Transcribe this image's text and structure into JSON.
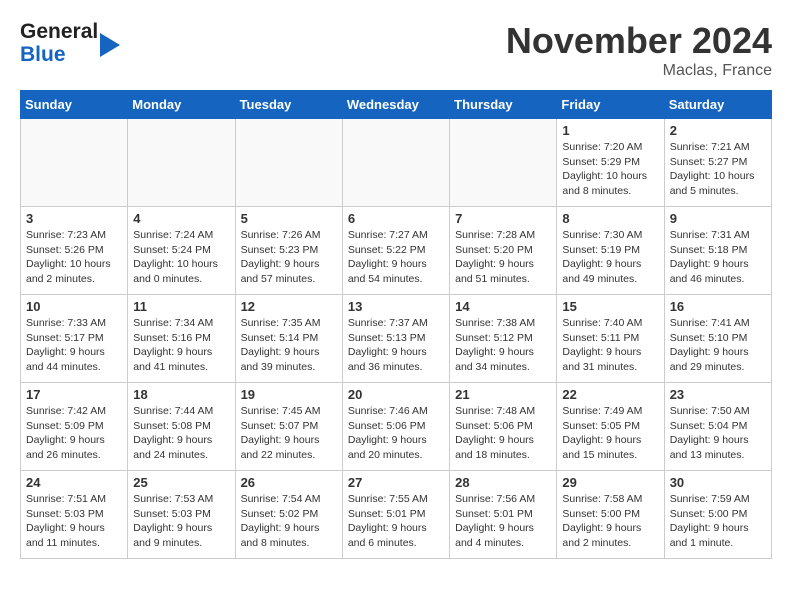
{
  "header": {
    "logo_top": "General",
    "logo_bottom": "Blue",
    "month_title": "November 2024",
    "location": "Maclas, France"
  },
  "weekdays": [
    "Sunday",
    "Monday",
    "Tuesday",
    "Wednesday",
    "Thursday",
    "Friday",
    "Saturday"
  ],
  "weeks": [
    [
      {
        "day": "",
        "info": ""
      },
      {
        "day": "",
        "info": ""
      },
      {
        "day": "",
        "info": ""
      },
      {
        "day": "",
        "info": ""
      },
      {
        "day": "",
        "info": ""
      },
      {
        "day": "1",
        "info": "Sunrise: 7:20 AM\nSunset: 5:29 PM\nDaylight: 10 hours and 8 minutes."
      },
      {
        "day": "2",
        "info": "Sunrise: 7:21 AM\nSunset: 5:27 PM\nDaylight: 10 hours and 5 minutes."
      }
    ],
    [
      {
        "day": "3",
        "info": "Sunrise: 7:23 AM\nSunset: 5:26 PM\nDaylight: 10 hours and 2 minutes."
      },
      {
        "day": "4",
        "info": "Sunrise: 7:24 AM\nSunset: 5:24 PM\nDaylight: 10 hours and 0 minutes."
      },
      {
        "day": "5",
        "info": "Sunrise: 7:26 AM\nSunset: 5:23 PM\nDaylight: 9 hours and 57 minutes."
      },
      {
        "day": "6",
        "info": "Sunrise: 7:27 AM\nSunset: 5:22 PM\nDaylight: 9 hours and 54 minutes."
      },
      {
        "day": "7",
        "info": "Sunrise: 7:28 AM\nSunset: 5:20 PM\nDaylight: 9 hours and 51 minutes."
      },
      {
        "day": "8",
        "info": "Sunrise: 7:30 AM\nSunset: 5:19 PM\nDaylight: 9 hours and 49 minutes."
      },
      {
        "day": "9",
        "info": "Sunrise: 7:31 AM\nSunset: 5:18 PM\nDaylight: 9 hours and 46 minutes."
      }
    ],
    [
      {
        "day": "10",
        "info": "Sunrise: 7:33 AM\nSunset: 5:17 PM\nDaylight: 9 hours and 44 minutes."
      },
      {
        "day": "11",
        "info": "Sunrise: 7:34 AM\nSunset: 5:16 PM\nDaylight: 9 hours and 41 minutes."
      },
      {
        "day": "12",
        "info": "Sunrise: 7:35 AM\nSunset: 5:14 PM\nDaylight: 9 hours and 39 minutes."
      },
      {
        "day": "13",
        "info": "Sunrise: 7:37 AM\nSunset: 5:13 PM\nDaylight: 9 hours and 36 minutes."
      },
      {
        "day": "14",
        "info": "Sunrise: 7:38 AM\nSunset: 5:12 PM\nDaylight: 9 hours and 34 minutes."
      },
      {
        "day": "15",
        "info": "Sunrise: 7:40 AM\nSunset: 5:11 PM\nDaylight: 9 hours and 31 minutes."
      },
      {
        "day": "16",
        "info": "Sunrise: 7:41 AM\nSunset: 5:10 PM\nDaylight: 9 hours and 29 minutes."
      }
    ],
    [
      {
        "day": "17",
        "info": "Sunrise: 7:42 AM\nSunset: 5:09 PM\nDaylight: 9 hours and 26 minutes."
      },
      {
        "day": "18",
        "info": "Sunrise: 7:44 AM\nSunset: 5:08 PM\nDaylight: 9 hours and 24 minutes."
      },
      {
        "day": "19",
        "info": "Sunrise: 7:45 AM\nSunset: 5:07 PM\nDaylight: 9 hours and 22 minutes."
      },
      {
        "day": "20",
        "info": "Sunrise: 7:46 AM\nSunset: 5:06 PM\nDaylight: 9 hours and 20 minutes."
      },
      {
        "day": "21",
        "info": "Sunrise: 7:48 AM\nSunset: 5:06 PM\nDaylight: 9 hours and 18 minutes."
      },
      {
        "day": "22",
        "info": "Sunrise: 7:49 AM\nSunset: 5:05 PM\nDaylight: 9 hours and 15 minutes."
      },
      {
        "day": "23",
        "info": "Sunrise: 7:50 AM\nSunset: 5:04 PM\nDaylight: 9 hours and 13 minutes."
      }
    ],
    [
      {
        "day": "24",
        "info": "Sunrise: 7:51 AM\nSunset: 5:03 PM\nDaylight: 9 hours and 11 minutes."
      },
      {
        "day": "25",
        "info": "Sunrise: 7:53 AM\nSunset: 5:03 PM\nDaylight: 9 hours and 9 minutes."
      },
      {
        "day": "26",
        "info": "Sunrise: 7:54 AM\nSunset: 5:02 PM\nDaylight: 9 hours and 8 minutes."
      },
      {
        "day": "27",
        "info": "Sunrise: 7:55 AM\nSunset: 5:01 PM\nDaylight: 9 hours and 6 minutes."
      },
      {
        "day": "28",
        "info": "Sunrise: 7:56 AM\nSunset: 5:01 PM\nDaylight: 9 hours and 4 minutes."
      },
      {
        "day": "29",
        "info": "Sunrise: 7:58 AM\nSunset: 5:00 PM\nDaylight: 9 hours and 2 minutes."
      },
      {
        "day": "30",
        "info": "Sunrise: 7:59 AM\nSunset: 5:00 PM\nDaylight: 9 hours and 1 minute."
      }
    ]
  ]
}
